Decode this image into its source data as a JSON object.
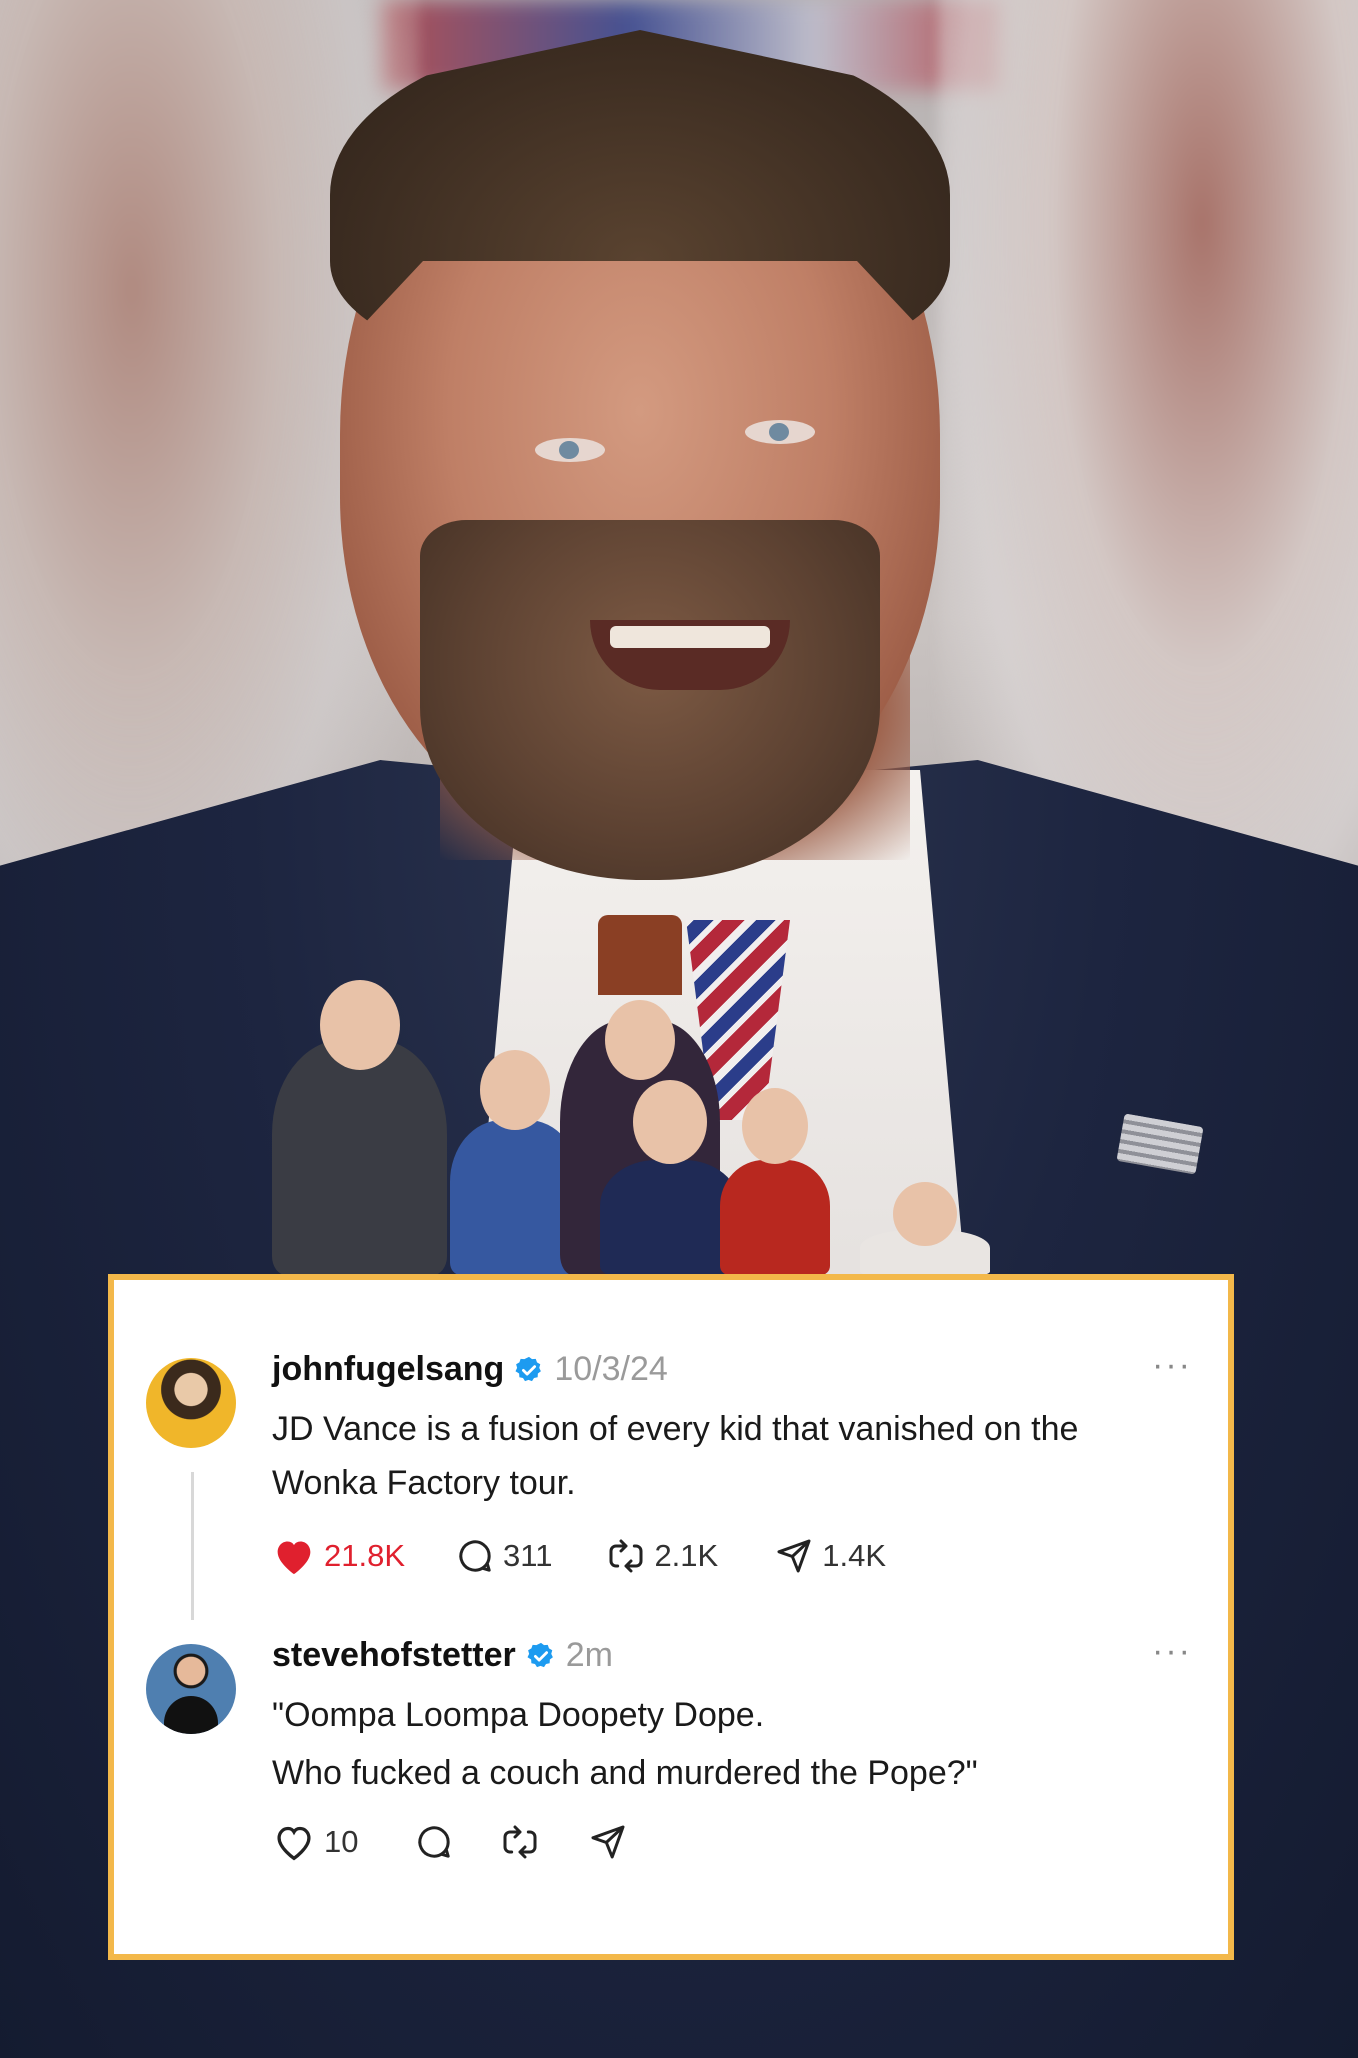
{
  "posts": [
    {
      "username": "johnfugelsang",
      "timestamp": "10/3/24",
      "more": "···",
      "lines": [
        "JD Vance is a fusion of every kid that vanished on the",
        "Wonka Factory tour."
      ],
      "likes": "21.8K",
      "liked": true,
      "replies": "311",
      "reposts": "2.1K",
      "shares": "1.4K"
    },
    {
      "username": "stevehofstetter",
      "timestamp": "2m",
      "more": "···",
      "lines": [
        "\"Oompa Loompa Doopety Dope.",
        "Who fucked a couch and murdered the Pope?\""
      ],
      "likes": "10",
      "liked": false
    }
  ],
  "colors": {
    "like_red": "#e0202e",
    "verified_blue": "#1d9bf0",
    "card_border": "#f3b84a"
  },
  "icons": [
    "heart-icon",
    "reply-icon",
    "repost-icon",
    "share-icon",
    "verified-badge-icon",
    "more-icon"
  ]
}
